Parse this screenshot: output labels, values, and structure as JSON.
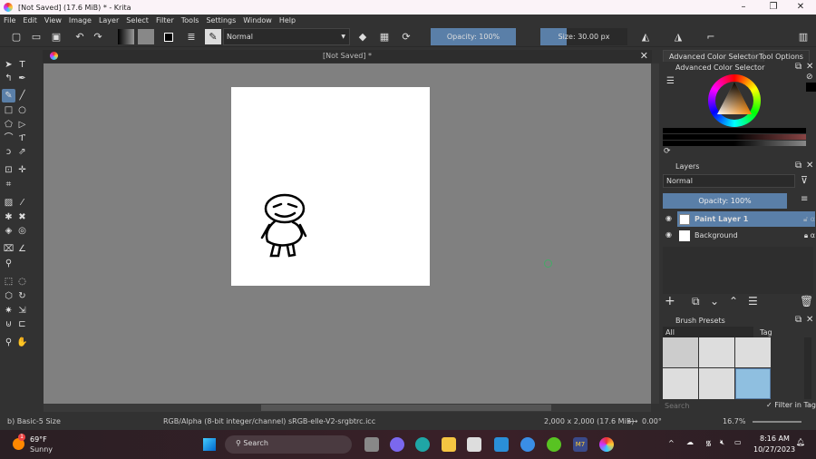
{
  "window": {
    "title": "[Not Saved]  (17.6 MiB)  * - Krita",
    "minimize": "–",
    "restore": "❐",
    "close": "✕"
  },
  "menu": [
    "File",
    "Edit",
    "View",
    "Image",
    "Layer",
    "Select",
    "Filter",
    "Tools",
    "Settings",
    "Window",
    "Help"
  ],
  "toolbar": {
    "blend_mode": "Normal",
    "opacity": "Opacity: 100%",
    "opacity_value": 100,
    "size": "Size: 30.00 px",
    "size_fill_percent": 30
  },
  "document": {
    "tab_title": "[Not Saved]  *"
  },
  "dock": {
    "tabs": [
      "Advanced Color Selector",
      "Tool Options"
    ],
    "color_selector": {
      "title": "Advanced Color Selector",
      "foreground": "#000000"
    },
    "layers": {
      "title": "Layers",
      "blend_mode": "Normal",
      "opacity": "Opacity:  100%",
      "items": [
        {
          "name": "Paint Layer 1",
          "selected": true,
          "locked": false
        },
        {
          "name": "Background",
          "selected": false,
          "locked": true
        }
      ]
    },
    "brush_presets": {
      "title": "Brush Presets",
      "filter": "All",
      "tag": "Tag",
      "search_placeholder": "Search",
      "filter_in_tag": "Filter in Tag"
    }
  },
  "status": {
    "brush": "b) Basic-5 Size",
    "color_space": "RGB/Alpha (8-bit integer/channel)  sRGB-elle-V2-srgbtrc.icc",
    "dimensions": "2,000 x 2,000 (17.6 MiB)",
    "rotation": "0.00°",
    "zoom": "16.7%"
  },
  "taskbar": {
    "weather_temp": "69°F",
    "weather_desc": "Sunny",
    "weather_badge": "1",
    "search": "Search",
    "time": "8:16 AM",
    "date": "10/27/2023"
  },
  "colors": {
    "accent": "#5a7fa8",
    "panel": "#323232",
    "canvas_bg": "#808080"
  }
}
